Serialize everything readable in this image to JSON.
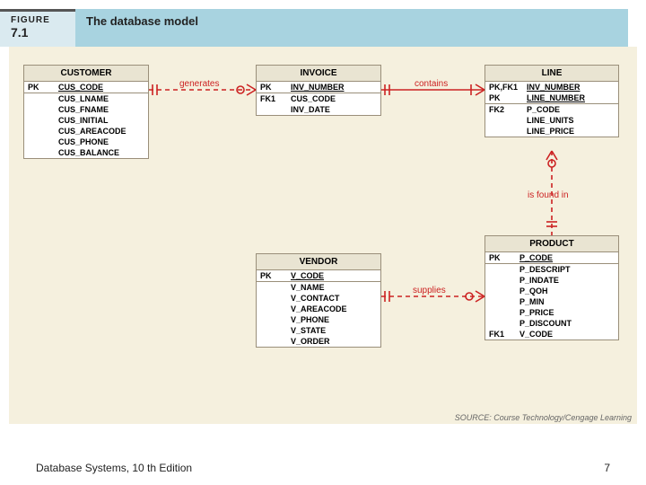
{
  "figure": {
    "label": "FIGURE",
    "number": "7.1",
    "title": "The database model"
  },
  "entities": {
    "customer": {
      "name": "CUSTOMER",
      "pk": [
        {
          "key": "PK",
          "attr": "CUS_CODE"
        }
      ],
      "attrs": [
        {
          "key": "",
          "attr": "CUS_LNAME"
        },
        {
          "key": "",
          "attr": "CUS_FNAME"
        },
        {
          "key": "",
          "attr": "CUS_INITIAL"
        },
        {
          "key": "",
          "attr": "CUS_AREACODE"
        },
        {
          "key": "",
          "attr": "CUS_PHONE"
        },
        {
          "key": "",
          "attr": "CUS_BALANCE"
        }
      ]
    },
    "invoice": {
      "name": "INVOICE",
      "pk": [
        {
          "key": "PK",
          "attr": "INV_NUMBER"
        }
      ],
      "attrs": [
        {
          "key": "FK1",
          "attr": "CUS_CODE"
        },
        {
          "key": "",
          "attr": "INV_DATE"
        }
      ]
    },
    "line": {
      "name": "LINE",
      "pk": [
        {
          "key": "PK,FK1",
          "attr": "INV_NUMBER"
        },
        {
          "key": "PK",
          "attr": "LINE_NUMBER"
        }
      ],
      "attrs": [
        {
          "key": "FK2",
          "attr": "P_CODE"
        },
        {
          "key": "",
          "attr": "LINE_UNITS"
        },
        {
          "key": "",
          "attr": "LINE_PRICE"
        }
      ]
    },
    "vendor": {
      "name": "VENDOR",
      "pk": [
        {
          "key": "PK",
          "attr": "V_CODE"
        }
      ],
      "attrs": [
        {
          "key": "",
          "attr": "V_NAME"
        },
        {
          "key": "",
          "attr": "V_CONTACT"
        },
        {
          "key": "",
          "attr": "V_AREACODE"
        },
        {
          "key": "",
          "attr": "V_PHONE"
        },
        {
          "key": "",
          "attr": "V_STATE"
        },
        {
          "key": "",
          "attr": "V_ORDER"
        }
      ]
    },
    "product": {
      "name": "PRODUCT",
      "pk": [
        {
          "key": "PK",
          "attr": "P_CODE"
        }
      ],
      "attrs": [
        {
          "key": "",
          "attr": "P_DESCRIPT"
        },
        {
          "key": "",
          "attr": "P_INDATE"
        },
        {
          "key": "",
          "attr": "P_QOH"
        },
        {
          "key": "",
          "attr": "P_MIN"
        },
        {
          "key": "",
          "attr": "P_PRICE"
        },
        {
          "key": "",
          "attr": "P_DISCOUNT"
        },
        {
          "key": "FK1",
          "attr": "V_CODE"
        }
      ]
    }
  },
  "relationships": {
    "generates": "generates",
    "contains": "contains",
    "isfoundin": "is found in",
    "supplies": "supplies"
  },
  "credit": "SOURCE: Course Technology/Cengage Learning",
  "footer": {
    "left": "Database Systems, 10 th Edition",
    "page": "7"
  }
}
